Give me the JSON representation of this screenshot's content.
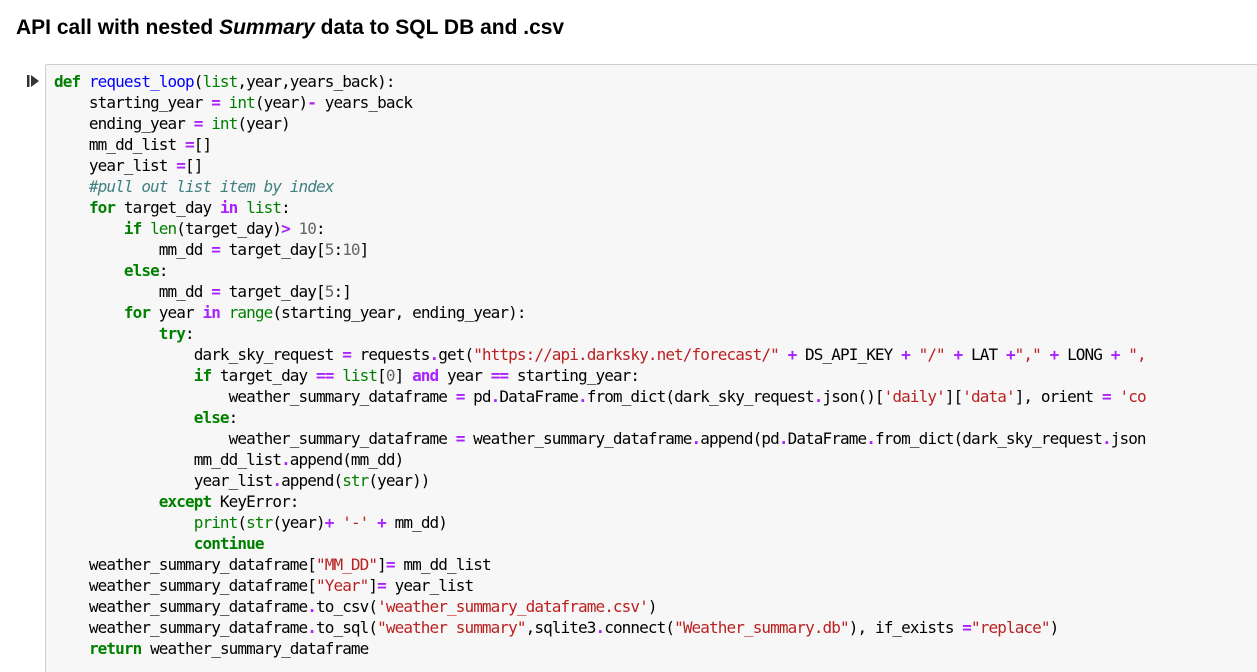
{
  "heading": {
    "prefix": "API call with nested ",
    "emphasis": "Summary",
    "suffix": " data to SQL DB and .csv"
  },
  "cell": {
    "run_icon": "step-run-icon",
    "lines": [
      [
        {
          "t": "def",
          "c": "kw"
        },
        {
          "t": " ",
          "c": "plain"
        },
        {
          "t": "request_loop",
          "c": "fn"
        },
        {
          "t": "(",
          "c": "plain"
        },
        {
          "t": "list",
          "c": "bi"
        },
        {
          "t": ",year,years_back):",
          "c": "plain"
        }
      ],
      [
        {
          "t": "    starting_year ",
          "c": "plain"
        },
        {
          "t": "=",
          "c": "op"
        },
        {
          "t": " ",
          "c": "plain"
        },
        {
          "t": "int",
          "c": "bi"
        },
        {
          "t": "(year)",
          "c": "plain"
        },
        {
          "t": "-",
          "c": "op"
        },
        {
          "t": " years_back",
          "c": "plain"
        }
      ],
      [
        {
          "t": "    ending_year ",
          "c": "plain"
        },
        {
          "t": "=",
          "c": "op"
        },
        {
          "t": " ",
          "c": "plain"
        },
        {
          "t": "int",
          "c": "bi"
        },
        {
          "t": "(year)",
          "c": "plain"
        }
      ],
      [
        {
          "t": "    mm_dd_list ",
          "c": "plain"
        },
        {
          "t": "=",
          "c": "op"
        },
        {
          "t": "[]",
          "c": "plain"
        }
      ],
      [
        {
          "t": "    year_list ",
          "c": "plain"
        },
        {
          "t": "=",
          "c": "op"
        },
        {
          "t": "[]",
          "c": "plain"
        }
      ],
      [
        {
          "t": "    #pull out list item by index",
          "c": "cm"
        }
      ],
      [
        {
          "t": "    ",
          "c": "plain"
        },
        {
          "t": "for",
          "c": "kw"
        },
        {
          "t": " target_day ",
          "c": "plain"
        },
        {
          "t": "in",
          "c": "op"
        },
        {
          "t": " ",
          "c": "plain"
        },
        {
          "t": "list",
          "c": "bi"
        },
        {
          "t": ":",
          "c": "plain"
        }
      ],
      [
        {
          "t": "        ",
          "c": "plain"
        },
        {
          "t": "if",
          "c": "kw"
        },
        {
          "t": " ",
          "c": "plain"
        },
        {
          "t": "len",
          "c": "bi"
        },
        {
          "t": "(target_day)",
          "c": "plain"
        },
        {
          "t": ">",
          "c": "op"
        },
        {
          "t": " ",
          "c": "plain"
        },
        {
          "t": "10",
          "c": "num"
        },
        {
          "t": ":",
          "c": "plain"
        }
      ],
      [
        {
          "t": "            mm_dd ",
          "c": "plain"
        },
        {
          "t": "=",
          "c": "op"
        },
        {
          "t": " target_day[",
          "c": "plain"
        },
        {
          "t": "5",
          "c": "num"
        },
        {
          "t": ":",
          "c": "plain"
        },
        {
          "t": "10",
          "c": "num"
        },
        {
          "t": "]",
          "c": "plain"
        }
      ],
      [
        {
          "t": "        ",
          "c": "plain"
        },
        {
          "t": "else",
          "c": "kw"
        },
        {
          "t": ":",
          "c": "plain"
        }
      ],
      [
        {
          "t": "            mm_dd ",
          "c": "plain"
        },
        {
          "t": "=",
          "c": "op"
        },
        {
          "t": " target_day[",
          "c": "plain"
        },
        {
          "t": "5",
          "c": "num"
        },
        {
          "t": ":]",
          "c": "plain"
        }
      ],
      [
        {
          "t": "        ",
          "c": "plain"
        },
        {
          "t": "for",
          "c": "kw"
        },
        {
          "t": " year ",
          "c": "plain"
        },
        {
          "t": "in",
          "c": "op"
        },
        {
          "t": " ",
          "c": "plain"
        },
        {
          "t": "range",
          "c": "bi"
        },
        {
          "t": "(starting_year, ending_year):",
          "c": "plain"
        }
      ],
      [
        {
          "t": "            ",
          "c": "plain"
        },
        {
          "t": "try",
          "c": "kw"
        },
        {
          "t": ":",
          "c": "plain"
        }
      ],
      [
        {
          "t": "                dark_sky_request ",
          "c": "plain"
        },
        {
          "t": "=",
          "c": "op"
        },
        {
          "t": " requests",
          "c": "plain"
        },
        {
          "t": ".",
          "c": "op"
        },
        {
          "t": "get(",
          "c": "plain"
        },
        {
          "t": "\"https://api.darksky.net/forecast/\"",
          "c": "str"
        },
        {
          "t": " ",
          "c": "plain"
        },
        {
          "t": "+",
          "c": "op"
        },
        {
          "t": " DS_API_KEY ",
          "c": "plain"
        },
        {
          "t": "+",
          "c": "op"
        },
        {
          "t": " ",
          "c": "plain"
        },
        {
          "t": "\"/\"",
          "c": "str"
        },
        {
          "t": " ",
          "c": "plain"
        },
        {
          "t": "+",
          "c": "op"
        },
        {
          "t": " LAT ",
          "c": "plain"
        },
        {
          "t": "+",
          "c": "op"
        },
        {
          "t": "\",\"",
          "c": "str"
        },
        {
          "t": " ",
          "c": "plain"
        },
        {
          "t": "+",
          "c": "op"
        },
        {
          "t": " LONG ",
          "c": "plain"
        },
        {
          "t": "+",
          "c": "op"
        },
        {
          "t": " ",
          "c": "plain"
        },
        {
          "t": "\",",
          "c": "str"
        }
      ],
      [
        {
          "t": "                ",
          "c": "plain"
        },
        {
          "t": "if",
          "c": "kw"
        },
        {
          "t": " target_day ",
          "c": "plain"
        },
        {
          "t": "==",
          "c": "op"
        },
        {
          "t": " ",
          "c": "plain"
        },
        {
          "t": "list",
          "c": "bi"
        },
        {
          "t": "[",
          "c": "plain"
        },
        {
          "t": "0",
          "c": "num"
        },
        {
          "t": "] ",
          "c": "plain"
        },
        {
          "t": "and",
          "c": "op"
        },
        {
          "t": " year ",
          "c": "plain"
        },
        {
          "t": "==",
          "c": "op"
        },
        {
          "t": " starting_year:",
          "c": "plain"
        }
      ],
      [
        {
          "t": "                    weather_summary_dataframe ",
          "c": "plain"
        },
        {
          "t": "=",
          "c": "op"
        },
        {
          "t": " pd",
          "c": "plain"
        },
        {
          "t": ".",
          "c": "op"
        },
        {
          "t": "DataFrame",
          "c": "plain"
        },
        {
          "t": ".",
          "c": "op"
        },
        {
          "t": "from_dict(dark_sky_request",
          "c": "plain"
        },
        {
          "t": ".",
          "c": "op"
        },
        {
          "t": "json()[",
          "c": "plain"
        },
        {
          "t": "'daily'",
          "c": "str"
        },
        {
          "t": "][",
          "c": "plain"
        },
        {
          "t": "'data'",
          "c": "str"
        },
        {
          "t": "], orient ",
          "c": "plain"
        },
        {
          "t": "=",
          "c": "op"
        },
        {
          "t": " ",
          "c": "plain"
        },
        {
          "t": "'co",
          "c": "str"
        }
      ],
      [
        {
          "t": "                ",
          "c": "plain"
        },
        {
          "t": "else",
          "c": "kw"
        },
        {
          "t": ":",
          "c": "plain"
        }
      ],
      [
        {
          "t": "                    weather_summary_dataframe ",
          "c": "plain"
        },
        {
          "t": "=",
          "c": "op"
        },
        {
          "t": " weather_summary_dataframe",
          "c": "plain"
        },
        {
          "t": ".",
          "c": "op"
        },
        {
          "t": "append(pd",
          "c": "plain"
        },
        {
          "t": ".",
          "c": "op"
        },
        {
          "t": "DataFrame",
          "c": "plain"
        },
        {
          "t": ".",
          "c": "op"
        },
        {
          "t": "from_dict(dark_sky_request",
          "c": "plain"
        },
        {
          "t": ".",
          "c": "op"
        },
        {
          "t": "json",
          "c": "plain"
        }
      ],
      [
        {
          "t": "                mm_dd_list",
          "c": "plain"
        },
        {
          "t": ".",
          "c": "op"
        },
        {
          "t": "append(mm_dd)",
          "c": "plain"
        }
      ],
      [
        {
          "t": "                year_list",
          "c": "plain"
        },
        {
          "t": ".",
          "c": "op"
        },
        {
          "t": "append(",
          "c": "plain"
        },
        {
          "t": "str",
          "c": "bi"
        },
        {
          "t": "(year))",
          "c": "plain"
        }
      ],
      [
        {
          "t": "            ",
          "c": "plain"
        },
        {
          "t": "except",
          "c": "kw"
        },
        {
          "t": " KeyError:",
          "c": "plain"
        }
      ],
      [
        {
          "t": "                ",
          "c": "plain"
        },
        {
          "t": "print",
          "c": "bi"
        },
        {
          "t": "(",
          "c": "plain"
        },
        {
          "t": "str",
          "c": "bi"
        },
        {
          "t": "(year)",
          "c": "plain"
        },
        {
          "t": "+",
          "c": "op"
        },
        {
          "t": " ",
          "c": "plain"
        },
        {
          "t": "'-'",
          "c": "str"
        },
        {
          "t": " ",
          "c": "plain"
        },
        {
          "t": "+",
          "c": "op"
        },
        {
          "t": " mm_dd)",
          "c": "plain"
        }
      ],
      [
        {
          "t": "                ",
          "c": "plain"
        },
        {
          "t": "continue",
          "c": "kw"
        }
      ],
      [
        {
          "t": "    weather_summary_dataframe[",
          "c": "plain"
        },
        {
          "t": "\"MM_DD\"",
          "c": "str"
        },
        {
          "t": "]",
          "c": "plain"
        },
        {
          "t": "=",
          "c": "op"
        },
        {
          "t": " mm_dd_list",
          "c": "plain"
        }
      ],
      [
        {
          "t": "    weather_summary_dataframe[",
          "c": "plain"
        },
        {
          "t": "\"Year\"",
          "c": "str"
        },
        {
          "t": "]",
          "c": "plain"
        },
        {
          "t": "=",
          "c": "op"
        },
        {
          "t": " year_list",
          "c": "plain"
        }
      ],
      [
        {
          "t": "    weather_summary_dataframe",
          "c": "plain"
        },
        {
          "t": ".",
          "c": "op"
        },
        {
          "t": "to_csv(",
          "c": "plain"
        },
        {
          "t": "'weather_summary_dataframe.csv'",
          "c": "str"
        },
        {
          "t": ")",
          "c": "plain"
        }
      ],
      [
        {
          "t": "    weather_summary_dataframe",
          "c": "plain"
        },
        {
          "t": ".",
          "c": "op"
        },
        {
          "t": "to_sql(",
          "c": "plain"
        },
        {
          "t": "\"weather summary\"",
          "c": "str"
        },
        {
          "t": ",sqlite3",
          "c": "plain"
        },
        {
          "t": ".",
          "c": "op"
        },
        {
          "t": "connect(",
          "c": "plain"
        },
        {
          "t": "\"Weather_summary.db\"",
          "c": "str"
        },
        {
          "t": "), if_exists ",
          "c": "plain"
        },
        {
          "t": "=",
          "c": "op"
        },
        {
          "t": "\"replace\"",
          "c": "str"
        },
        {
          "t": ")",
          "c": "plain"
        }
      ],
      [
        {
          "t": "    ",
          "c": "plain"
        },
        {
          "t": "return",
          "c": "kw"
        },
        {
          "t": " weather_summary_dataframe",
          "c": "plain"
        }
      ]
    ]
  }
}
